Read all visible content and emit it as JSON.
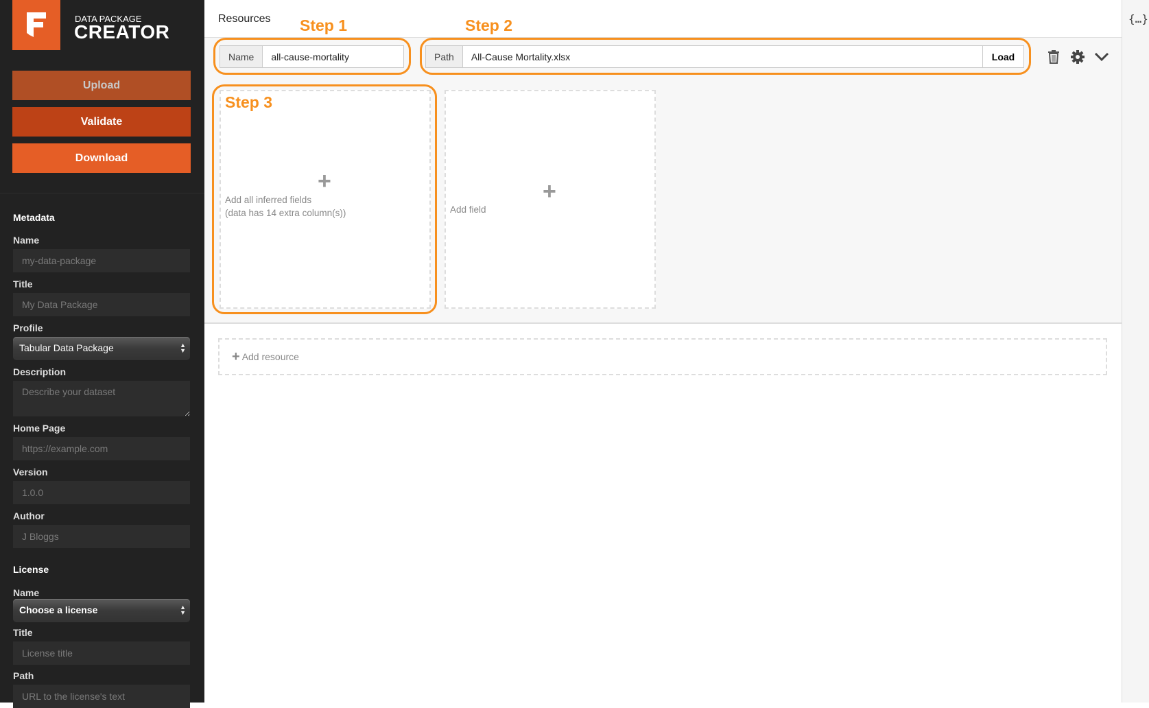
{
  "brand": {
    "line1": "DATA PACKAGE",
    "line2": "CREATOR",
    "logo_letter": "F",
    "color": "#e55e26"
  },
  "actions": {
    "upload": "Upload",
    "validate": "Validate",
    "download": "Download",
    "colors": {
      "upload": "#b04f25",
      "validate": "#bd4216",
      "download": "#e55e26"
    }
  },
  "metadata": {
    "heading": "Metadata",
    "name": {
      "label": "Name",
      "placeholder": "my-data-package"
    },
    "title": {
      "label": "Title",
      "placeholder": "My Data Package"
    },
    "profile": {
      "label": "Profile",
      "value": "Tabular Data Package"
    },
    "description": {
      "label": "Description",
      "placeholder": "Describe your dataset"
    },
    "homepage": {
      "label": "Home Page",
      "placeholder": "https://example.com"
    },
    "version": {
      "label": "Version",
      "placeholder": "1.0.0"
    },
    "author": {
      "label": "Author",
      "placeholder": "J Bloggs"
    }
  },
  "license": {
    "heading": "License",
    "name": {
      "label": "Name",
      "value": "Choose a license"
    },
    "title": {
      "label": "Title",
      "placeholder": "License title"
    },
    "path": {
      "label": "Path",
      "placeholder": "URL to the license's text"
    }
  },
  "main": {
    "title": "Resources",
    "steps": [
      "Step 1",
      "Step 2",
      "Step 3"
    ],
    "resource": {
      "name_label": "Name",
      "name_value": "all-cause-mortality",
      "path_label": "Path",
      "path_value": "All-Cause Mortality.xlsx",
      "load": "Load"
    },
    "infer": {
      "line1": "Add all inferred fields",
      "line2": "(data has 14 extra column(s))"
    },
    "add_field": "Add field",
    "add_resource": "Add resource",
    "highlight_color": "#f7901e"
  },
  "right_panel": {
    "json_icon": "{…}"
  }
}
